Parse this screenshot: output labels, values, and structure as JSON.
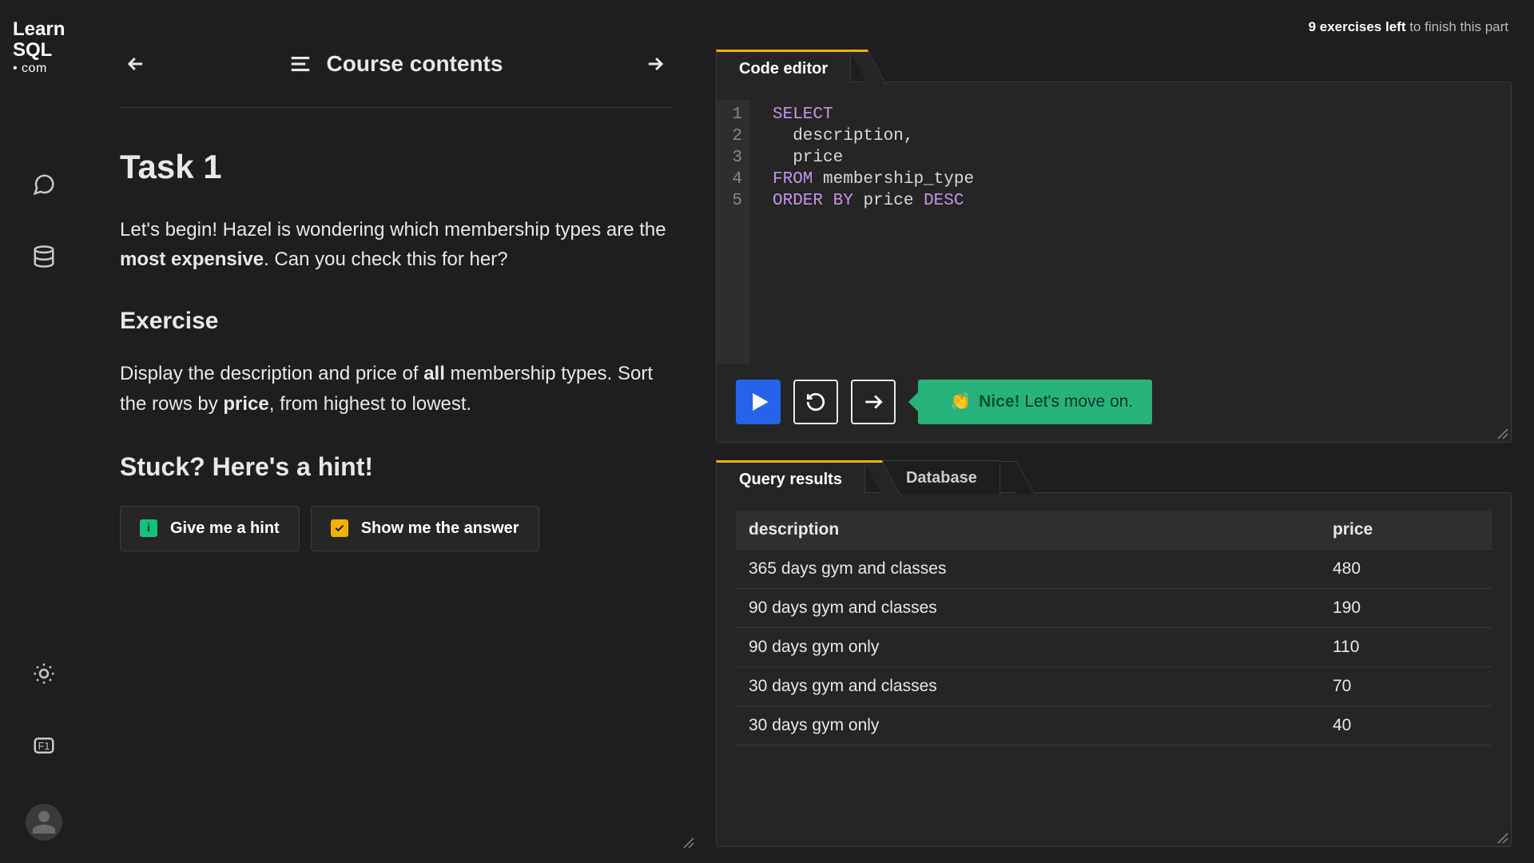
{
  "logo": {
    "line1": "Learn",
    "line2": "SQL",
    "line3": "• com"
  },
  "nav": {
    "contents_label": "Course contents"
  },
  "exercises_bar": {
    "bold": "9 exercises left",
    "rest": " to finish this part"
  },
  "task": {
    "heading": "Task 1",
    "intro_pre": "Let's begin! Hazel is wondering which membership types are the ",
    "intro_strong": "most expensive",
    "intro_post": ". Can you check this for her?",
    "exercise_heading": "Exercise",
    "exercise_p1_a": "Display the description and price of ",
    "exercise_p1_strong1": "all",
    "exercise_p1_b": " membership types. Sort the rows by ",
    "exercise_p1_strong2": "price",
    "exercise_p1_c": ", from highest to lowest.",
    "hint_heading": "Stuck? Here's a hint!",
    "hint_button": "Give me a hint",
    "answer_button": "Show me the answer"
  },
  "editor": {
    "tab_label": "Code editor",
    "line_numbers": [
      "1",
      "2",
      "3",
      "4",
      "5"
    ],
    "code": [
      {
        "tokens": [
          {
            "t": "SELECT",
            "c": "kw"
          }
        ]
      },
      {
        "tokens": [
          {
            "t": "  description,",
            "c": "ident"
          }
        ]
      },
      {
        "tokens": [
          {
            "t": "  price",
            "c": "ident"
          }
        ]
      },
      {
        "tokens": [
          {
            "t": "FROM",
            "c": "kw"
          },
          {
            "t": " membership_type",
            "c": "ident"
          }
        ]
      },
      {
        "tokens": [
          {
            "t": "ORDER",
            "c": "kw"
          },
          {
            "t": " ",
            "c": "ident"
          },
          {
            "t": "BY",
            "c": "kw"
          },
          {
            "t": " price ",
            "c": "ident"
          },
          {
            "t": "DESC",
            "c": "kw"
          }
        ]
      }
    ],
    "feedback_emoji": "👏",
    "feedback_nice": "Nice!",
    "feedback_rest": " Let's move on."
  },
  "results": {
    "tab_active": "Query results",
    "tab_inactive": "Database",
    "columns": [
      "description",
      "price"
    ],
    "rows": [
      [
        "365 days gym and classes",
        "480"
      ],
      [
        "90 days gym and classes",
        "190"
      ],
      [
        "90 days gym only",
        "110"
      ],
      [
        "30 days gym and classes",
        "70"
      ],
      [
        "30 days gym only",
        "40"
      ]
    ]
  }
}
